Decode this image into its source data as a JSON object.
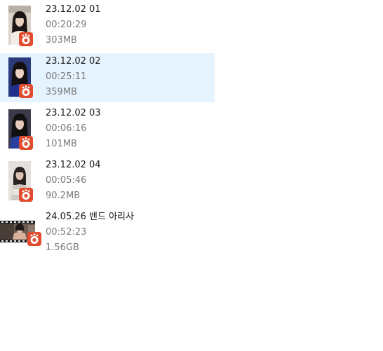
{
  "files": [
    {
      "name": "23.12.02 01",
      "duration": "00:20:29",
      "size": "303MB",
      "selected": false,
      "thumbnail": "portrait-photo",
      "app_icon": "player-app-icon",
      "badge_color": "#e14d2e"
    },
    {
      "name": "23.12.02 02",
      "duration": "00:25:11",
      "size": "359MB",
      "selected": true,
      "thumbnail": "portrait-photo",
      "app_icon": "player-app-icon",
      "badge_color": "#e14d2e"
    },
    {
      "name": "23.12.02 03",
      "duration": "00:06:16",
      "size": "101MB",
      "selected": false,
      "thumbnail": "portrait-photo",
      "app_icon": "player-app-icon",
      "badge_color": "#e14d2e"
    },
    {
      "name": "23.12.02 04",
      "duration": "00:05:46",
      "size": "90.2MB",
      "selected": false,
      "thumbnail": "portrait-photo",
      "app_icon": "player-app-icon",
      "badge_color": "#e14d2e"
    },
    {
      "name": "24.05.26 밴드 아리사",
      "duration": "00:52:23",
      "size": "1.56GB",
      "selected": false,
      "thumbnail": "film-strip-photo",
      "app_icon": "player-app-icon",
      "badge_color": "#e14d2e"
    }
  ],
  "colors": {
    "selection": "#e5f3ff",
    "primary_text": "#1a1a1a",
    "secondary_text": "#7a7a7a"
  }
}
